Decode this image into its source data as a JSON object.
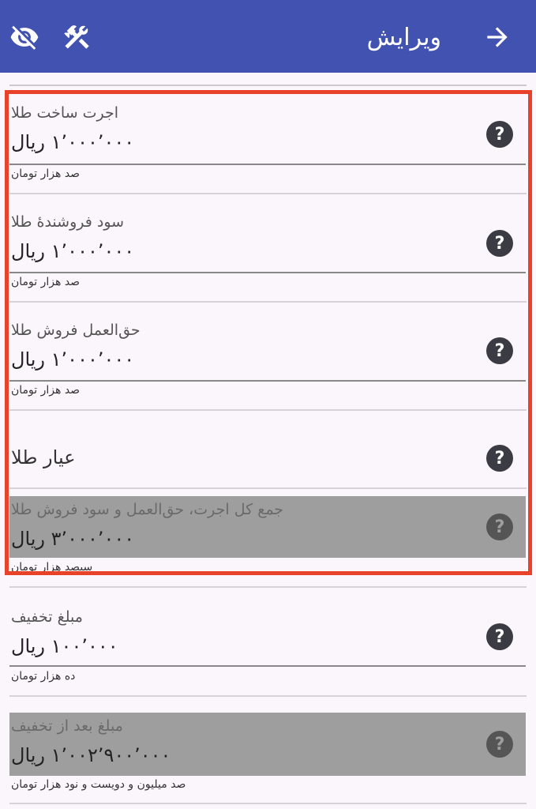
{
  "appbar": {
    "title": "ویرایش",
    "icons": [
      "arrow-right-icon",
      "eye-off-icon",
      "tools-icon"
    ]
  },
  "fields": [
    {
      "label": "اجرت ساخت طلا",
      "value": "۱٬۰۰۰٬۰۰۰ ریال",
      "words": "صد هزار تومان"
    },
    {
      "label": "سود فروشندهٔ طلا",
      "value": "۱٬۰۰۰٬۰۰۰ ریال",
      "words": "صد هزار تومان"
    },
    {
      "label": "حق‌العمل فروش طلا",
      "value": "۱٬۰۰۰٬۰۰۰ ریال",
      "words": "صد هزار تومان"
    },
    {
      "label": "عیار طلا"
    },
    {
      "label": "جمع کل اجرت، حق‌العمل و سود فروش طلا",
      "value": "۳٬۰۰۰٬۰۰۰ ریال",
      "words": "سیصد هزار تومان"
    },
    {
      "label": "مبلغ تخفیف",
      "value": "۱۰۰٬۰۰۰ ریال",
      "words": "ده هزار تومان"
    },
    {
      "label": "مبلغ بعد از تخفیف",
      "value": "۱٬۰۰۲٬۹۰۰٬۰۰۰ ریال",
      "words": "صد میلیون و دویست و نود هزار تومان"
    }
  ],
  "help_glyph": "?",
  "colors": {
    "appbar": "#4152b0",
    "background": "#fbf6fb",
    "highlight_border": "#e8422a",
    "disabled_field": "#9e9e9e"
  }
}
